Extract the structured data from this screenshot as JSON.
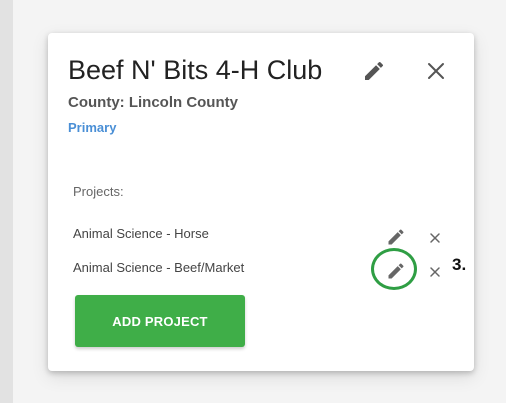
{
  "card": {
    "title": "Beef N' Bits 4-H Club",
    "county": "County: Lincoln County",
    "status": "Primary",
    "projects_label": "Projects:",
    "projects": [
      {
        "name": "Animal Science - Horse"
      },
      {
        "name": "Animal Science - Beef/Market"
      }
    ],
    "add_button_label": "ADD PROJECT"
  },
  "annotation": {
    "step_label": "3."
  },
  "icons": {
    "edit": "pencil-icon",
    "close": "close-icon"
  },
  "colors": {
    "accent_green": "#3fae48",
    "primary_blue": "#4a8fd6",
    "highlight_ring": "#2f9e44"
  }
}
